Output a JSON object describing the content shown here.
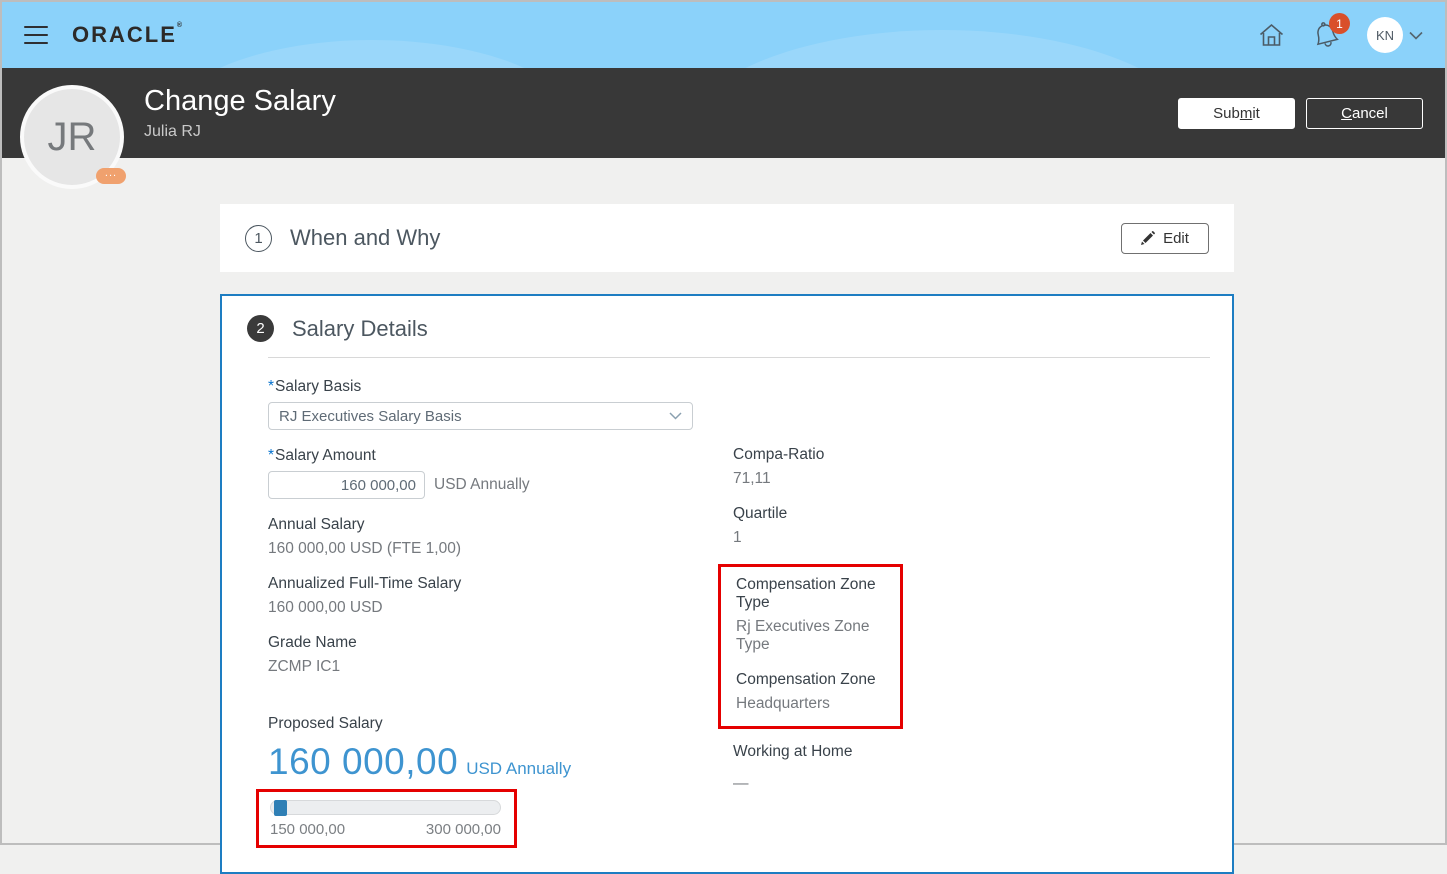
{
  "topbar": {
    "brand": "ORACLE",
    "brand_mark": "®",
    "notification_count": "1",
    "user_initials": "KN"
  },
  "header": {
    "title": "Change Salary",
    "subtitle": "Julia RJ",
    "avatar_initials": "JR",
    "avatar_more": "...",
    "submit": {
      "pre": "Sub",
      "key": "m",
      "post": "it"
    },
    "cancel": {
      "pre": "",
      "key": "C",
      "post": "ancel"
    }
  },
  "sections": {
    "when_why": {
      "number": "1",
      "title": "When and Why",
      "edit_label": "Edit"
    },
    "salary_details": {
      "number": "2",
      "title": "Salary Details"
    }
  },
  "form": {
    "salary_basis": {
      "required_marker": "*",
      "label": "Salary Basis",
      "value": "RJ Executives Salary Basis"
    },
    "salary_amount": {
      "required_marker": "*",
      "label": "Salary Amount",
      "value": "160 000,00",
      "suffix": "USD Annually"
    },
    "annual_salary": {
      "label": "Annual Salary",
      "value": "160 000,00 USD (FTE 1,00)"
    },
    "annualized_full_time_salary": {
      "label": "Annualized Full-Time Salary",
      "value": "160 000,00 USD"
    },
    "grade_name": {
      "label": "Grade Name",
      "value": "ZCMP IC1"
    },
    "compa_ratio": {
      "label": "Compa-Ratio",
      "value": "71,11"
    },
    "quartile": {
      "label": "Quartile",
      "value": "1"
    },
    "compensation_zone_type": {
      "label": "Compensation Zone Type",
      "value": "Rj Executives Zone Type"
    },
    "compensation_zone": {
      "label": "Compensation Zone",
      "value": "Headquarters"
    },
    "working_at_home": {
      "label": "Working at Home",
      "value": "—"
    },
    "proposed_salary": {
      "label": "Proposed Salary",
      "amount": "160 000,00",
      "suffix": "USD Annually",
      "slider_min": "150 000,00",
      "slider_max": "300 000,00"
    }
  },
  "colors": {
    "topbar_blue": "#8bd2fa",
    "header_dark": "#383838",
    "accent_blue": "#0572ce",
    "section_border_blue": "#1d7dc2",
    "proposed_blue": "#3e94d0",
    "highlight_red": "#e50000",
    "notification_badge": "#d9502a"
  }
}
